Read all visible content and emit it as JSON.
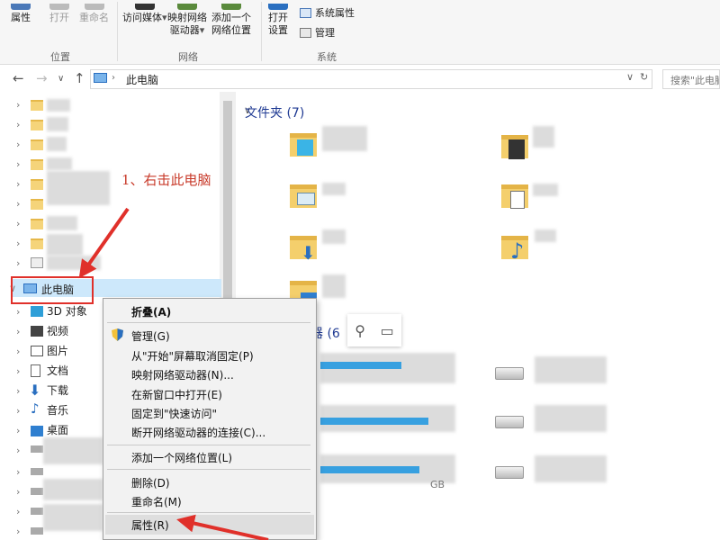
{
  "ribbon": {
    "properties": "属性",
    "open": "打开",
    "rename": "重命名",
    "location_group": "位置",
    "access_media": "访问媒体",
    "map_drive_1": "映射网络",
    "map_drive_2": "驱动器",
    "add_location_1": "添加一个",
    "add_location_2": "网络位置",
    "network_group": "网络",
    "open_settings_1": "打开",
    "open_settings_2": "设置",
    "system_properties": "系统属性",
    "manage": "管理",
    "system_group": "系统"
  },
  "address": {
    "path": "此电脑",
    "search_placeholder": "搜索\"此电脑\""
  },
  "nav": {
    "this_pc": "此电脑",
    "items": [
      "3D 对象",
      "视频",
      "图片",
      "文档",
      "下载",
      "音乐",
      "桌面"
    ]
  },
  "annotation": "1、右击此电脑",
  "content": {
    "folders_label": "文件夹",
    "folders_count": "(7)",
    "devices_label": "器",
    "devices_count": "(6",
    "drive_size_fragment": "GB"
  },
  "context_menu": {
    "collapse": "折叠(A)",
    "manage": "管理(G)",
    "unpin_start": "从\"开始\"屏幕取消固定(P)",
    "map_drive": "映射网络驱动器(N)...",
    "open_new_window": "在新窗口中打开(E)",
    "pin_quick": "固定到\"快速访问\"",
    "disconnect_drive": "断开网络驱动器的连接(C)...",
    "add_network_location": "添加一个网络位置(L)",
    "delete": "删除(D)",
    "rename": "重命名(M)",
    "properties": "属性(R)"
  },
  "colors": {
    "accent": "#2a6fc0",
    "annotation_red": "#e0302a",
    "selection": "#cde8fb"
  }
}
